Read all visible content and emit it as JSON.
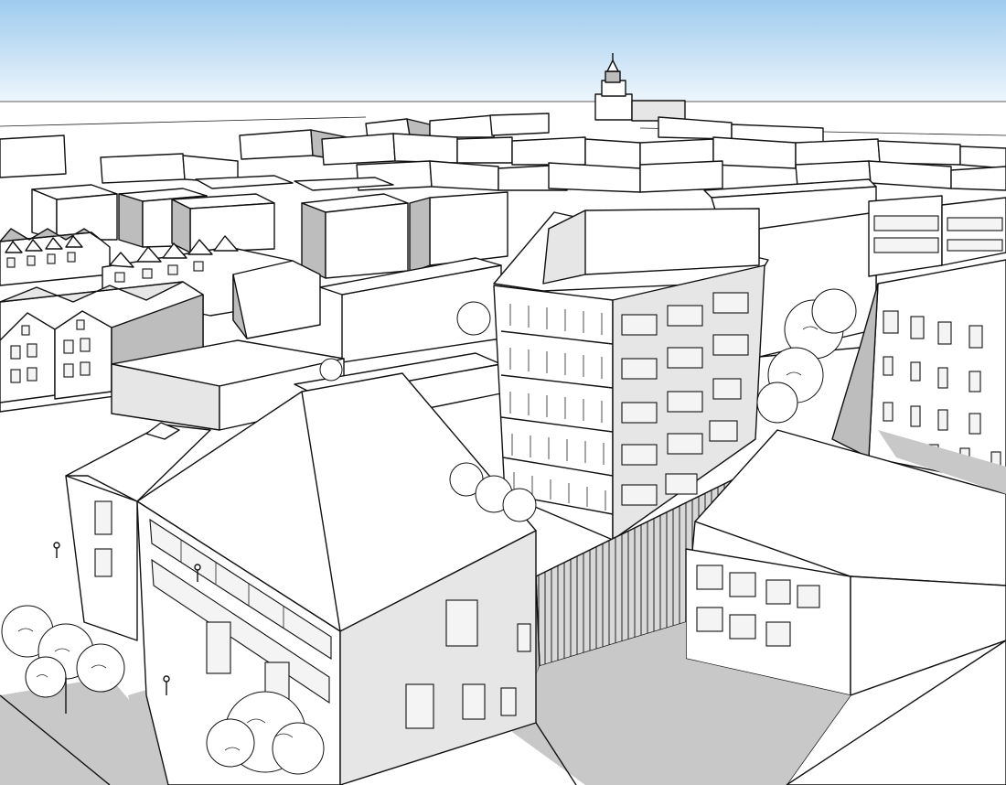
{
  "scene": {
    "kind": "3d-massing-model-render",
    "style": "monochrome sketch line drawing",
    "colors": {
      "sky_top": "#9ecbee",
      "sky_bottom": "#eef6fc",
      "facade_lit": "#ffffff",
      "facade_shade": "#bdbdbd",
      "shadow": "#c8c8c8",
      "edge": "#111111"
    },
    "landmarks": [
      "church-tower",
      "corner-tower-building",
      "l-shaped-block",
      "slatted-screen-wall",
      "terrace-houses",
      "trees"
    ]
  }
}
